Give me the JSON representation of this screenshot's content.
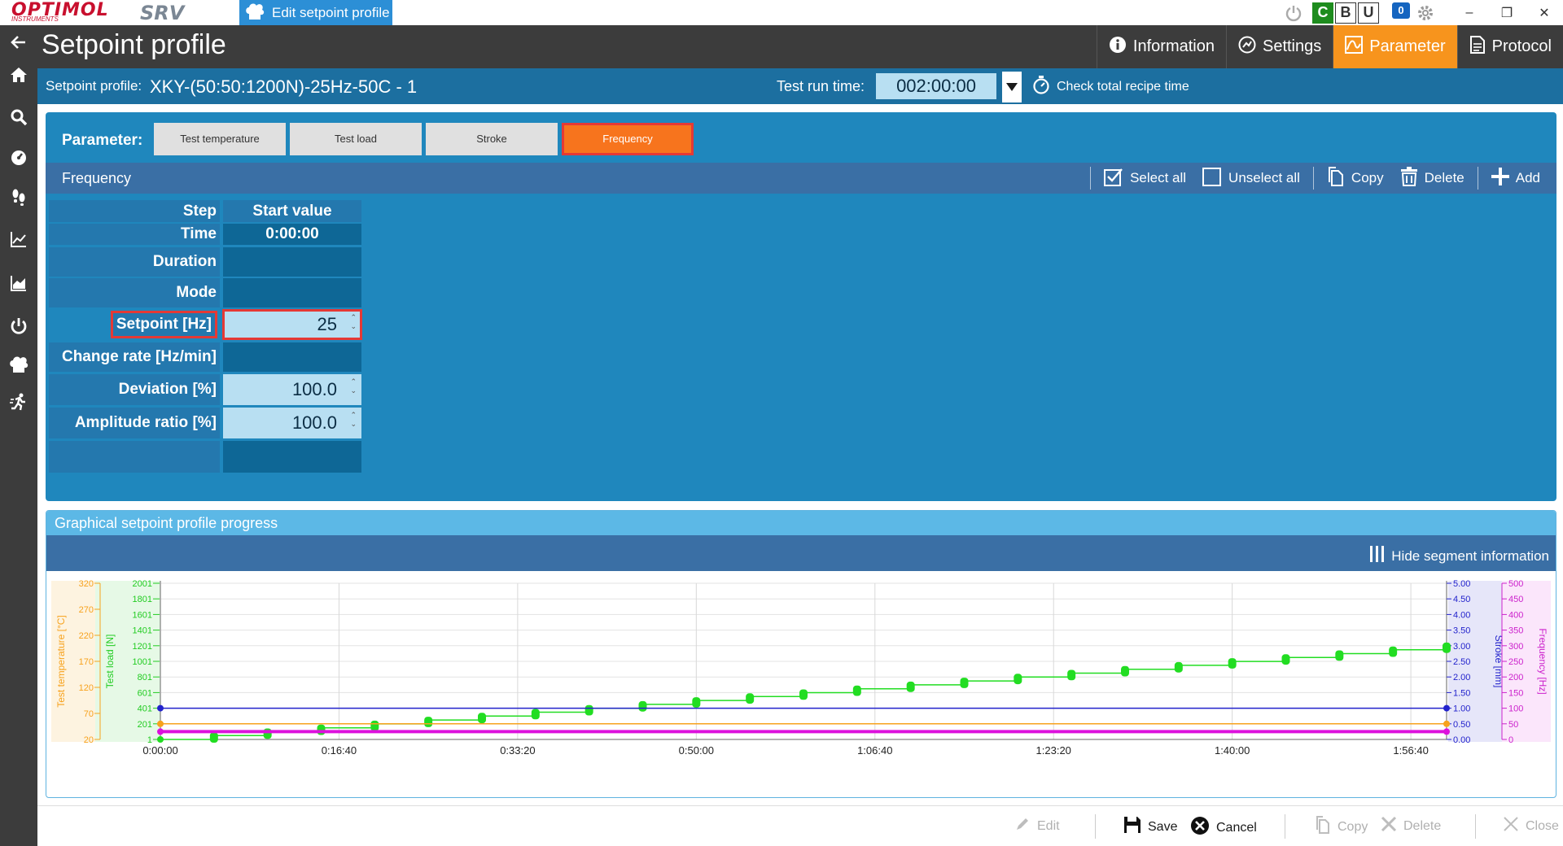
{
  "titlebar": {
    "logo_primary": "OPTIMOL",
    "logo_secondary": "INSTRUMENTS",
    "logo_product": "SRV",
    "active_window": "Edit setpoint profile",
    "badge_c": "C",
    "badge_b": "B",
    "badge_u": "U",
    "notification_count": "0"
  },
  "header": {
    "title": "Setpoint profile",
    "nav": [
      {
        "label": "Information",
        "icon": "info-icon"
      },
      {
        "label": "Settings",
        "icon": "settings-icon"
      },
      {
        "label": "Parameter",
        "icon": "chart-icon",
        "active": true
      },
      {
        "label": "Protocol",
        "icon": "document-icon"
      }
    ]
  },
  "infobar": {
    "profile_label": "Setpoint profile:",
    "profile_value": "XKY-(50:50:1200N)-25Hz-50C - 1",
    "runtime_label": "Test run time:",
    "runtime_value": "002:00:00",
    "check_recipe": "Check total recipe time"
  },
  "parameter": {
    "label": "Parameter:",
    "buttons": [
      "Test temperature",
      "Test load",
      "Stroke",
      "Frequency"
    ],
    "active": "Frequency"
  },
  "frequency": {
    "title": "Frequency",
    "actions": {
      "select_all": "Select all",
      "unselect_all": "Unselect all",
      "copy": "Copy",
      "delete": "Delete",
      "add": "Add"
    },
    "table": {
      "step_label": "Step",
      "step_value": "Start value",
      "time_label": "Time",
      "time_value": "0:00:00",
      "duration_label": "Duration",
      "mode_label": "Mode",
      "setpoint_label": "Setpoint [Hz]",
      "setpoint_value": "25",
      "change_rate_label": "Change rate [Hz/min]",
      "deviation_label": "Deviation [%]",
      "deviation_value": "100.0",
      "amplitude_label": "Amplitude ratio [%]",
      "amplitude_value": "100.0"
    }
  },
  "graph": {
    "title": "Graphical setpoint profile progress",
    "hide_segment": "Hide segment information"
  },
  "chart_data": {
    "type": "line",
    "x_tick_labels": [
      "0:00:00",
      "0:16:40",
      "0:33:20",
      "0:50:00",
      "1:06:40",
      "1:23:20",
      "1:40:00",
      "1:56:40"
    ],
    "xlim_minutes": [
      0,
      120
    ],
    "axes": {
      "temperature": {
        "label": "Test temperature [°C]",
        "ticks": [
          "320",
          "270",
          "220",
          "170",
          "120",
          "70",
          "20"
        ],
        "ylim": [
          20,
          320
        ],
        "color": "#f7a21d"
      },
      "load": {
        "label": "Test load [N]",
        "ticks": [
          "2001",
          "1801",
          "1601",
          "1401",
          "1201",
          "1001",
          "801",
          "601",
          "401",
          "201",
          "1"
        ],
        "ylim": [
          1,
          2001
        ],
        "color": "#22cc22"
      },
      "stroke": {
        "label": "Stroke [mm]",
        "ticks": [
          "5.00",
          "4.50",
          "4.00",
          "3.50",
          "3.00",
          "2.50",
          "2.00",
          "1.50",
          "1.00",
          "0.50",
          "0.00"
        ],
        "ylim": [
          0,
          5
        ],
        "color": "#2222cc"
      },
      "frequency": {
        "label": "Frequency [Hz]",
        "ticks": [
          "500",
          "450",
          "400",
          "350",
          "300",
          "250",
          "200",
          "150",
          "100",
          "50",
          "0"
        ],
        "ylim": [
          0,
          500
        ],
        "color": "#cc22cc"
      }
    },
    "series": [
      {
        "axis": "load",
        "color": "#22dd22",
        "type": "step",
        "x_minutes": [
          0,
          5,
          10,
          15,
          20,
          25,
          30,
          35,
          40,
          45,
          50,
          55,
          60,
          65,
          70,
          75,
          80,
          85,
          90,
          95,
          100,
          105,
          110,
          115,
          120
        ],
        "values": [
          1,
          50,
          100,
          150,
          200,
          250,
          300,
          350,
          400,
          450,
          500,
          550,
          600,
          650,
          700,
          750,
          800,
          850,
          900,
          950,
          1000,
          1050,
          1100,
          1150,
          1200
        ]
      },
      {
        "axis": "stroke",
        "color": "#2222cc",
        "x_minutes": [
          0,
          120
        ],
        "values": [
          1.0,
          1.0
        ]
      },
      {
        "axis": "temperature",
        "color": "#f7a21d",
        "x_minutes": [
          0,
          120
        ],
        "values": [
          50,
          50
        ]
      },
      {
        "axis": "frequency",
        "color": "#dd11dd",
        "x_minutes": [
          0,
          120
        ],
        "values": [
          25,
          25
        ]
      }
    ]
  },
  "footer": {
    "edit": "Edit",
    "save": "Save",
    "cancel": "Cancel",
    "copy": "Copy",
    "delete": "Delete",
    "close": "Close"
  }
}
